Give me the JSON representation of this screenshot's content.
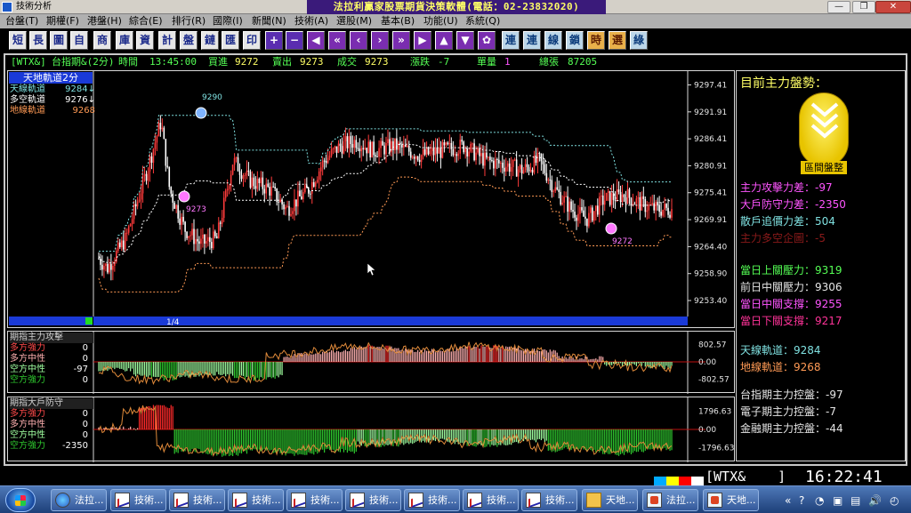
{
  "window": {
    "title": "技術分析",
    "banner": "法拉利贏家股票期貨決策軟體(電話：02-23832020)",
    "min_icon": "minimize-icon",
    "max_icon": "restore-icon",
    "close_icon": "close-icon"
  },
  "menu": [
    "台盤(T)",
    "期權(F)",
    "港盤(H)",
    "綜合(E)",
    "排行(R)",
    "國際(I)",
    "新聞(N)",
    "技術(A)",
    "選股(M)",
    "基本(B)",
    "功能(U)",
    "系統(Q)"
  ],
  "toolbar": {
    "text_buttons": [
      "短",
      "長",
      "圖",
      "自",
      "商",
      "庫",
      "資",
      "計",
      "盤",
      "鏈",
      "匯",
      "印"
    ],
    "nav_icons": [
      "plus-icon",
      "minus-icon",
      "step-left-icon",
      "double-left-icon",
      "left-icon",
      "right-icon",
      "double-right-icon",
      "step-right-icon",
      "up-icon",
      "down-icon",
      "magic-icon"
    ],
    "right_buttons": [
      "連",
      "連",
      "線",
      "鎖",
      "時",
      "選",
      "綠"
    ]
  },
  "quote": {
    "symbol": "[WTX&]",
    "name": "台指期&(2分)",
    "time_label": "時間",
    "time": "13:45:00",
    "bid_label": "買進",
    "bid": "9272",
    "ask_label": "賣出",
    "ask": "9273",
    "trade_label": "成交",
    "trade": "9273",
    "change_label": "漲跌",
    "change": "-7",
    "volume_label": "單量",
    "volume": "1",
    "total_label": "總張",
    "total": "87205"
  },
  "price_panel": {
    "header": "天地軌道2分",
    "legend": [
      {
        "label": "天線軌道",
        "value": "9284↓",
        "color": "#7fe0e0"
      },
      {
        "label": "多空軌道",
        "value": "9276↓",
        "color": "#ffffff"
      },
      {
        "label": "地線軌道",
        "value": "9268",
        "color": "#ff9a55"
      }
    ],
    "page_indicator": "1/4",
    "markers": {
      "high": "9290",
      "mid": "9273",
      "low": "9272"
    },
    "y_ticks": [
      "9297.41",
      "9291.91",
      "9286.41",
      "9280.91",
      "9275.41",
      "9269.91",
      "9264.40",
      "9258.90",
      "9253.40"
    ],
    "ylim": [
      9250.5,
      9299.5
    ]
  },
  "attack_panel": {
    "header": "期指主力攻擊",
    "legend": [
      {
        "label": "多方強力",
        "value": "0",
        "color": "#ff4a4a"
      },
      {
        "label": "多方中性",
        "value": "0",
        "color": "#ffb0b0"
      },
      {
        "label": "空方中性",
        "value": "-97",
        "color": "#a0ffa0"
      },
      {
        "label": "空方強力",
        "value": "0",
        "color": "#2ec82e"
      }
    ],
    "y_ticks": [
      "802.57",
      "0.00",
      "-802.57"
    ]
  },
  "defense_panel": {
    "header": "期指大戶防守",
    "legend": [
      {
        "label": "多方強力",
        "value": "0",
        "color": "#ff4a4a"
      },
      {
        "label": "多方中性",
        "value": "0",
        "color": "#ffb0b0"
      },
      {
        "label": "空方中性",
        "value": "0",
        "color": "#a0ffa0"
      },
      {
        "label": "空方強力",
        "value": "-2350",
        "color": "#2ec82e"
      }
    ],
    "y_ticks": [
      "1796.63",
      "0.00",
      "-1796.63"
    ]
  },
  "info": {
    "title": "目前主力盤勢：",
    "badge_label": "區間盤整",
    "badge_icon": "chevron-down-icon",
    "stats": [
      {
        "label": "主力攻擊力差：",
        "value": "-97",
        "color": "#ff55ff"
      },
      {
        "label": "大戶防守力差：",
        "value": "-2350",
        "color": "#ff55ff"
      },
      {
        "label": "散戶追價力差：",
        "value": "504",
        "color": "#7fe0e0"
      },
      {
        "label": "主力多空企圖：",
        "value": "-5",
        "color": "#8a1a1a"
      }
    ],
    "levels": [
      {
        "label": "當日上關壓力：",
        "value": "9319",
        "color": "#55ff55"
      },
      {
        "label": "前日中關壓力：",
        "value": "9306",
        "color": "#e6e6e6"
      },
      {
        "label": "當日中關支撐：",
        "value": "9255",
        "color": "#ff55ff"
      },
      {
        "label": "當日下關支撐：",
        "value": "9217",
        "color": "#ff3399"
      }
    ],
    "tracks": [
      {
        "label": "天線軌道：",
        "value": "9284",
        "color": "#7fe0e0"
      },
      {
        "label": "地線軌道：",
        "value": "9268",
        "color": "#ff9a55"
      }
    ],
    "controls": [
      {
        "label": "台指期主力控盤：",
        "value": "-97",
        "color": "#e6e6e6"
      },
      {
        "label": "電子期主力控盤：",
        "value": "-7",
        "color": "#e6e6e6"
      },
      {
        "label": "金融期主力控盤：",
        "value": "-44",
        "color": "#e6e6e6"
      }
    ]
  },
  "status": {
    "code": "[WTX&",
    "code_close": "]",
    "clock": "16:22:41",
    "colors": [
      "#00aaff",
      "#ffff00",
      "#ff0000",
      "#ffffff"
    ]
  },
  "taskbar": {
    "items": [
      {
        "label": "法拉...",
        "icon": "ie-icon"
      },
      {
        "label": "技術...",
        "icon": "chart-icon"
      },
      {
        "label": "技術...",
        "icon": "chart-icon"
      },
      {
        "label": "技術...",
        "icon": "chart-icon"
      },
      {
        "label": "技術...",
        "icon": "chart-icon"
      },
      {
        "label": "技術...",
        "icon": "chart-icon"
      },
      {
        "label": "技術...",
        "icon": "chart-icon"
      },
      {
        "label": "技術...",
        "icon": "chart-icon"
      },
      {
        "label": "天地...",
        "icon": "folder-icon"
      },
      {
        "label": "法拉...",
        "icon": "app-icon"
      },
      {
        "label": "天地...",
        "icon": "app-icon"
      }
    ],
    "tray": [
      "«",
      "?",
      "◔",
      "▣",
      "▤",
      "🔊",
      "◴"
    ]
  }
}
